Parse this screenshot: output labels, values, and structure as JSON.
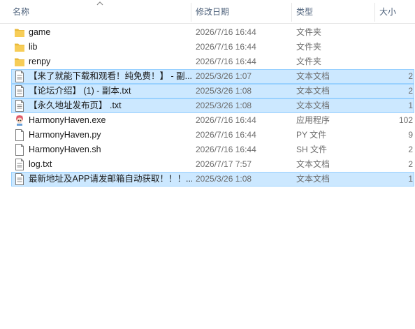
{
  "columns": {
    "name": "名称",
    "date": "修改日期",
    "type": "类型",
    "size": "大小"
  },
  "files": [
    {
      "name": "game",
      "date": "2026/7/16 16:44",
      "type": "文件夹",
      "size": "",
      "icon": "folder-icon",
      "selected": false
    },
    {
      "name": "lib",
      "date": "2026/7/16 16:44",
      "type": "文件夹",
      "size": "",
      "icon": "folder-icon",
      "selected": false
    },
    {
      "name": "renpy",
      "date": "2026/7/16 16:44",
      "type": "文件夹",
      "size": "",
      "icon": "folder-icon",
      "selected": false
    },
    {
      "name": "【来了就能下载和观看！纯免费！】 - 副...",
      "date": "2025/3/26 1:07",
      "type": "文本文档",
      "size": "2",
      "icon": "text-document-icon",
      "selected": true
    },
    {
      "name": "【论坛介绍】 (1) - 副本.txt",
      "date": "2025/3/26 1:08",
      "type": "文本文档",
      "size": "2",
      "icon": "text-document-icon",
      "selected": true
    },
    {
      "name": "【永久地址发布页】 .txt",
      "date": "2025/3/26 1:08",
      "type": "文本文档",
      "size": "1",
      "icon": "text-document-icon",
      "selected": true
    },
    {
      "name": "HarmonyHaven.exe",
      "date": "2026/7/16 16:44",
      "type": "应用程序",
      "size": "102",
      "icon": "application-icon",
      "selected": false
    },
    {
      "name": "HarmonyHaven.py",
      "date": "2026/7/16 16:44",
      "type": "PY 文件",
      "size": "9",
      "icon": "blank-file-icon",
      "selected": false
    },
    {
      "name": "HarmonyHaven.sh",
      "date": "2026/7/16 16:44",
      "type": "SH 文件",
      "size": "2",
      "icon": "blank-file-icon",
      "selected": false
    },
    {
      "name": "log.txt",
      "date": "2026/7/17 7:57",
      "type": "文本文档",
      "size": "2",
      "icon": "text-document-icon",
      "selected": false
    },
    {
      "name": "最新地址及APP请发邮箱自动获取！！！...",
      "date": "2025/3/26 1:08",
      "type": "文本文档",
      "size": "1",
      "icon": "text-document-icon",
      "selected": true
    }
  ],
  "colors": {
    "selection_bg": "#cce8ff",
    "selection_border": "#99d1ff",
    "folder": "#f5c84c",
    "header_text": "#4c607a"
  }
}
